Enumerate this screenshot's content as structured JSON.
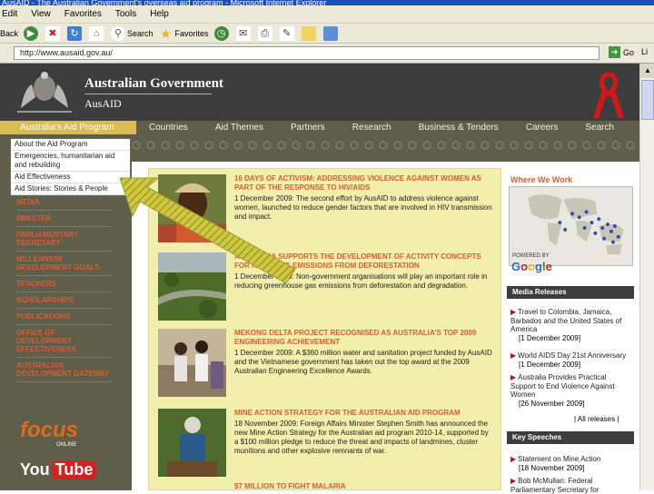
{
  "browser": {
    "title": "AusAID - The Australian Government's overseas aid program - Microsoft Internet Explorer",
    "menu": [
      "Edit",
      "View",
      "Favorites",
      "Tools",
      "Help"
    ],
    "toolbar": {
      "back": "Back",
      "search": "Search",
      "favorites": "Favorites"
    },
    "address": "http://www.ausaid.gov.au/",
    "go": "Go",
    "links": "Li"
  },
  "header": {
    "government": "Australian Government",
    "agency": "AusAID"
  },
  "nav": {
    "items": [
      "Australia's Aid Program",
      "Countries",
      "Aid Themes",
      "Partners",
      "Research",
      "Business & Tenders",
      "Careers",
      "Search"
    ]
  },
  "dropdown": {
    "items": [
      "About the Aid Program",
      "Emergencies, humanitarian aid and rebuilding",
      "Aid Effectiveness",
      "Aid Stories: Stories & People"
    ]
  },
  "left_links": [
    "MEDIA",
    "MINISTER",
    "PARLIAMENTARY SECRETARY",
    "MILLENNIUM DEVELOPMENT GOALS",
    "TEACHERS",
    "SCHOLARSHIPS",
    "PUBLICATIONS",
    "OFFICE OF DEVELOPMENT EFFECTIVENESS",
    "AUSTRALIAN DEVELOPMENT GATEWAY"
  ],
  "logos": {
    "focus": "focus",
    "focus_sub": "ONLINE",
    "youtube_you": "You",
    "youtube_tube": "Tube"
  },
  "stories": [
    {
      "headline": "16 DAYS OF ACTIVISM: ADDRESSING VIOLENCE AGAINST WOMEN AS PART OF THE RESPONSE TO HIV/AIDS",
      "body": "1 December 2009: The second effort by AusAID to address violence against women, launched to reduce gender factors that are involved in HIV transmission and impact."
    },
    {
      "headline": "AUSTRALIA SUPPORTS THE DEVELOPMENT OF ACTIVITY CONCEPTS FOR REDUCING EMISSIONS FROM DEFORESTATION",
      "body": "1 December 2009: Non-government organisations will play an important role in reducing greenhouse gas emissions from deforestation and degradation."
    },
    {
      "headline": "MEKONG DELTA PROJECT RECOGNISED AS AUSTRALIA'S TOP 2009 ENGINEERING ACHIEVEMENT",
      "body": "1 December 2009: A $360 million water and sanitation project funded by AusAID and the Vietnamese government has taken out the top award at the 2009 Australian Engineering Excellence Awards."
    },
    {
      "headline": "MINE ACTION STRATEGY FOR THE AUSTRALIAN AID PROGRAM",
      "body": "18 November 2009: Foreign Affairs Minister Stephen Smith has announced the new Mine Action Strategy for the Australian aid program 2010-14, supported by a $100 million pledge to reduce the threat and impacts of landmines, cluster munitions and other explosive remnants of war."
    },
    {
      "headline": "$7 MILLION TO FIGHT MALARIA",
      "body": ""
    }
  ],
  "right": {
    "where_we_work": "Where We Work",
    "powered_by": "POWERED BY",
    "google": "Google",
    "media_releases_title": "Media Releases",
    "media_releases": [
      {
        "title": "Travel to Colombia, Jamaica, Barbados and the United States of America",
        "date": "[1 December 2009]"
      },
      {
        "title": "World AIDS Day 21st Anniversary",
        "date": "[1 December 2009]"
      },
      {
        "title": "Australia Provides Practical Support to End Violence Against Women",
        "date": "[26 November 2009]"
      }
    ],
    "all_releases": "| All releases |",
    "key_speeches_title": "Key Speeches",
    "key_speeches": [
      {
        "title": "Statement on Mine Action",
        "date": "[18 November 2009]"
      },
      {
        "title": "Bob McMullan: Federal Parliamentary Secretary for",
        "date": ""
      }
    ]
  },
  "colors": {
    "accent": "#d95c31",
    "nav_bg": "#5e5e4a",
    "header_bg": "#3d3d3d",
    "news_bg": "#f2eeab",
    "active_tab": "#d9bc52",
    "pointer": "#c9c23a"
  }
}
